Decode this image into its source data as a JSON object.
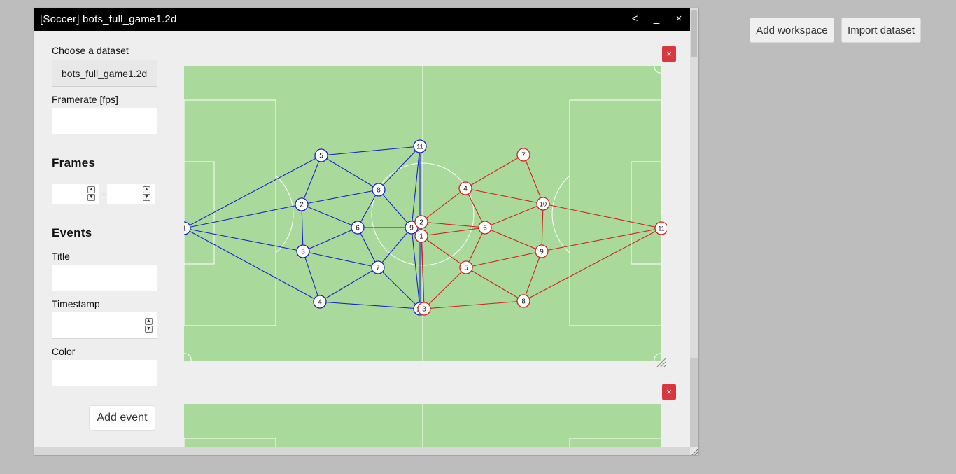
{
  "top_buttons": {
    "add_workspace": "Add workspace",
    "import_dataset": "Import dataset"
  },
  "window": {
    "title": "[Soccer] bots_full_game1.2d",
    "controls": {
      "back": "<",
      "minimize": "_",
      "close": "×"
    }
  },
  "sidebar": {
    "dataset_label": "Choose a dataset",
    "dataset_value": "bots_full_game1.2d",
    "framerate_label": "Framerate [fps]",
    "framerate_value": "",
    "frames_heading": "Frames",
    "frames_separator": "-",
    "events_heading": "Events",
    "title_label": "Title",
    "timestamp_label": "Timestamp",
    "color_label": "Color",
    "add_event_label": "Add event"
  },
  "panels": {
    "close_label": "×"
  },
  "colors": {
    "pitch": "#a9da9b",
    "lines": "#ffffff",
    "team_blue": "#1a22c8",
    "team_red": "#d4201a",
    "close_button": "#d9363e"
  },
  "field_graph": {
    "blue_team": [
      {
        "label": "1"
      },
      {
        "label": "2"
      },
      {
        "label": "3"
      },
      {
        "label": "4"
      },
      {
        "label": "5"
      },
      {
        "label": "6"
      },
      {
        "label": "7"
      },
      {
        "label": "8"
      },
      {
        "label": "9"
      },
      {
        "label": "10"
      },
      {
        "label": "11"
      }
    ],
    "red_team": [
      {
        "label": "1"
      },
      {
        "label": "2"
      },
      {
        "label": "3"
      },
      {
        "label": "4"
      },
      {
        "label": "5"
      },
      {
        "label": "6"
      },
      {
        "label": "7"
      },
      {
        "label": "8"
      },
      {
        "label": "9"
      },
      {
        "label": "10"
      },
      {
        "label": "11"
      }
    ]
  }
}
